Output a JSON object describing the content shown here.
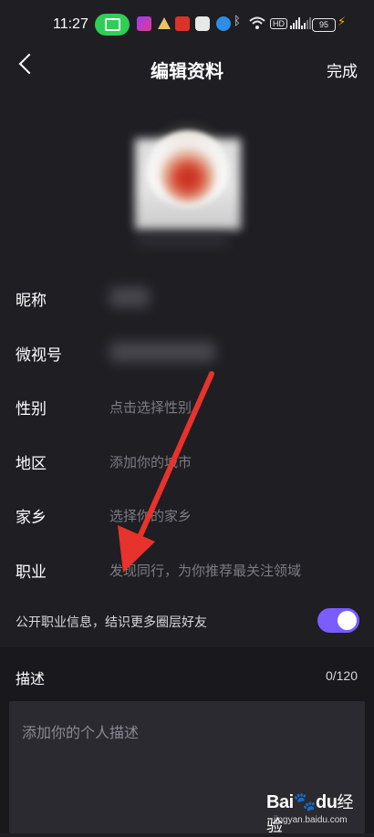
{
  "status_bar": {
    "time": "11:27",
    "hd_badge": "HD",
    "battery": "95",
    "icons": [
      "cast-icon",
      "video-app-icon",
      "app-icon",
      "news-app-icon",
      "app-icon",
      "notification-icon",
      "bluetooth-icon",
      "wifi-icon",
      "hd-icon",
      "signal-icon",
      "signal-icon",
      "battery-icon",
      "charging-icon"
    ]
  },
  "header": {
    "title": "编辑资料",
    "done_label": "完成",
    "back_icon": "chevron-left-icon"
  },
  "form": {
    "rows": [
      {
        "label": "昵称",
        "value": ""
      },
      {
        "label": "微视号",
        "value": ""
      },
      {
        "label": "性别",
        "value": "点击选择性别"
      },
      {
        "label": "地区",
        "value": "添加你的城市"
      },
      {
        "label": "家乡",
        "value": "选择你的家乡"
      },
      {
        "label": "职业",
        "value": "发现同行，为你推荐最关注领域"
      }
    ]
  },
  "toggle_row": {
    "label": "公开职业信息，结识更多圈层好友",
    "on": true,
    "accent": "#7a5cff"
  },
  "description": {
    "label": "描述",
    "count": "0/120",
    "placeholder": "添加你的个人描述"
  },
  "annotation": {
    "arrow_color": "#e8322c"
  },
  "watermark": {
    "logo_text": "Bai",
    "logo_text_2": "du",
    "logo_suffix": "经验",
    "sub": "jingyan.baidu.com"
  }
}
